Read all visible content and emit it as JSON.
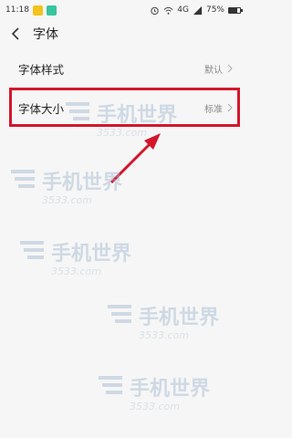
{
  "status_bar": {
    "time": "11:18",
    "network": "4G",
    "battery": "75%",
    "battery_level": 0.75
  },
  "header": {
    "title": "字体",
    "back_icon": "back-chevron-icon"
  },
  "settings": [
    {
      "label": "字体样式",
      "value": "默认"
    },
    {
      "label": "字体大小",
      "value": "标准"
    }
  ],
  "watermark": {
    "text": "手机世界",
    "subtext": "3533.com"
  },
  "colors": {
    "highlight": "#d3172b",
    "watermark": "#9fb8cf"
  }
}
